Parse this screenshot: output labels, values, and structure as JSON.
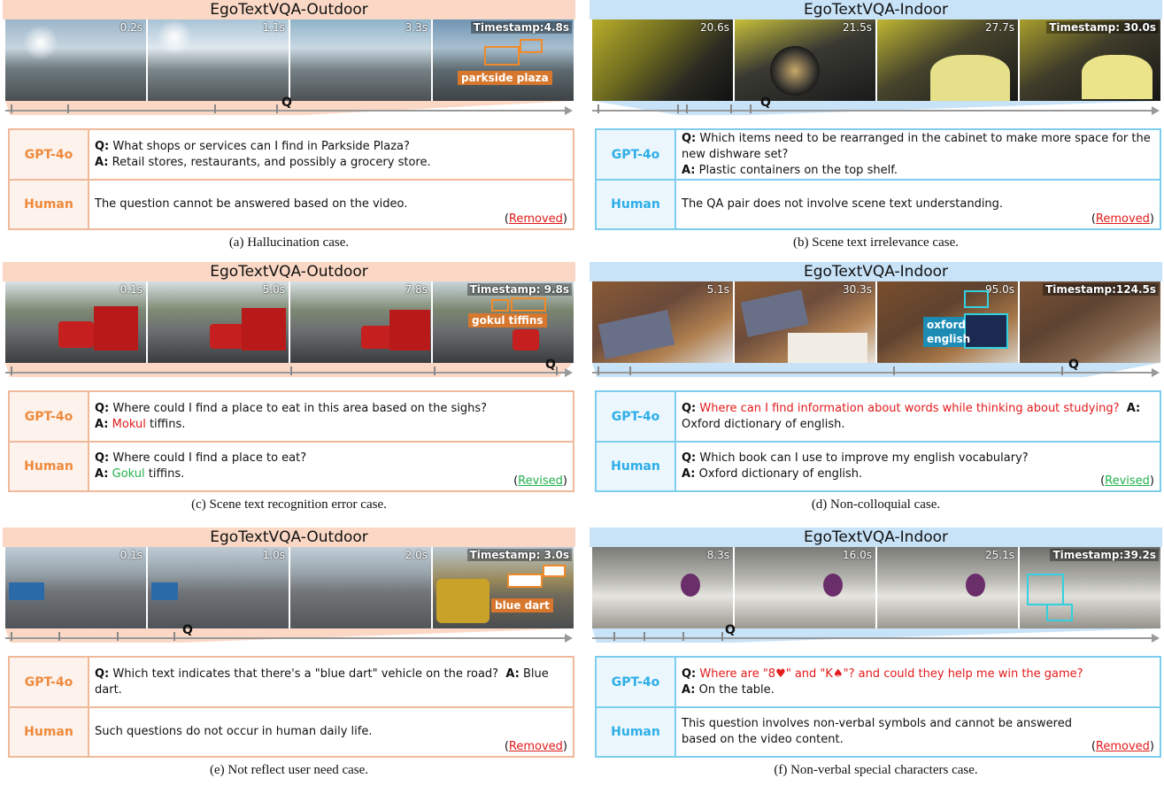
{
  "panels": [
    {
      "dataset": "EgoTextVQA-Outdoor",
      "timestamps": [
        "0.2s",
        "1.1s",
        "3.3s",
        "Timestamp:4.8s"
      ],
      "annotation": "parkside plaza",
      "gpt_label": "GPT-4o",
      "human_label": "Human",
      "gpt_q": "What shops or services can I find in Parkside Plaza?",
      "gpt_a": "Retail stores, restaurants, and possibly a grocery store.",
      "human_text": "The question cannot be answered based on the video.",
      "status": "Removed",
      "caption": "(a) Hallucination case."
    },
    {
      "dataset": "EgoTextVQA-Indoor",
      "timestamps": [
        "20.6s",
        "21.5s",
        "27.7s",
        "Timestamp: 30.0s"
      ],
      "gpt_label": "GPT-4o",
      "human_label": "Human",
      "gpt_q": "Which items need to be rearranged in the cabinet to make more space for the new dishware set?",
      "gpt_a": "Plastic containers on the top shelf.",
      "human_text": "The QA pair does not involve scene text understanding.",
      "status": "Removed",
      "caption": "(b) Scene text irrelevance case."
    },
    {
      "dataset": "EgoTextVQA-Outdoor",
      "timestamps": [
        "0.1s",
        "5.0s",
        "7.8s",
        "Timestamp: 9.8s"
      ],
      "annotation": "gokul tiffins",
      "gpt_label": "GPT-4o",
      "human_label": "Human",
      "gpt_q": "Where could I find a place to eat in this area based on the sighs?",
      "gpt_a_wrong": "Mokul",
      "gpt_a_rest": " tiffins.",
      "human_q": "Where could I find a place to eat?",
      "human_a_fix": "Gokul",
      "human_a_rest": " tiffins.",
      "status": "Revised",
      "caption": "(c)  Scene text recognition error case."
    },
    {
      "dataset": "EgoTextVQA-Indoor",
      "timestamps": [
        "5.1s",
        "30.3s",
        "95.0s",
        "Timestamp:124.5s"
      ],
      "annotation": "oxford english",
      "gpt_label": "GPT-4o",
      "human_label": "Human",
      "gpt_q": "Where can I find information about words while thinking about studying?",
      "gpt_a": "Oxford dictionary of english.",
      "human_q": "Which book can I use to improve my english vocabulary?",
      "human_a": "Oxford dictionary of english.",
      "status": "Revised",
      "caption": "(d) Non-colloquial case."
    },
    {
      "dataset": "EgoTextVQA-Outdoor",
      "timestamps": [
        "0.1s",
        "1.0s",
        "2.0s",
        "Timestamp: 3.0s"
      ],
      "annotation": "blue dart",
      "gpt_label": "GPT-4o",
      "human_label": "Human",
      "gpt_q": "Which text indicates that there's a \"blue dart\" vehicle on the road?",
      "gpt_a": "Blue dart.",
      "human_text": "Such questions do not occur in human daily life.",
      "status": "Removed",
      "caption": "(e)  Not reflect user need case."
    },
    {
      "dataset": "EgoTextVQA-Indoor",
      "timestamps": [
        "8.3s",
        "16.0s",
        "25.1s",
        "Timestamp:39.2s"
      ],
      "gpt_label": "GPT-4o",
      "human_label": "Human",
      "gpt_q": "Where are \"8♥\" and \"K♠\"? and could they help me win the game?",
      "gpt_a": "On the table.",
      "human_text": "This question involves non-verbal symbols and cannot be answered based on the video content.",
      "status": "Removed",
      "caption": "(f) Non-verbal special characters case."
    }
  ],
  "labels": {
    "q": "Q:",
    "a": "A:",
    "timeline_marker": "Q"
  }
}
